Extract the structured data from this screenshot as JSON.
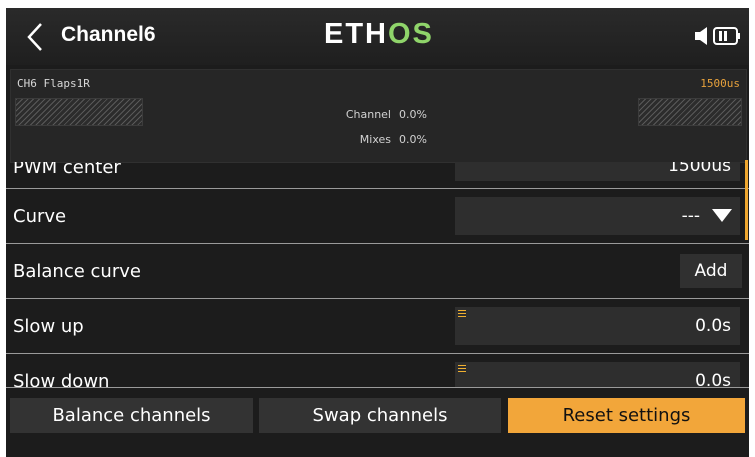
{
  "header": {
    "title": "Channel6",
    "logo_left": "ETH",
    "logo_right": "OS"
  },
  "output": {
    "channel_name": "CH6  Flaps1R",
    "value": "1500us",
    "channel_label": "Channel",
    "channel_value": "0.0%",
    "mixes_label": "Mixes",
    "mixes_value": "0.0%"
  },
  "rows": {
    "pwm_center": {
      "label": "PWM center",
      "value": "1500us"
    },
    "curve": {
      "label": "Curve",
      "value": "---"
    },
    "balance_curve": {
      "label": "Balance curve",
      "button": "Add"
    },
    "slow_up": {
      "label": "Slow up",
      "value": "0.0s"
    },
    "slow_down": {
      "label": "Slow down",
      "value": "0.0s"
    }
  },
  "buttons": {
    "balance": "Balance channels",
    "swap": "Swap channels",
    "reset": "Reset settings"
  },
  "colors": {
    "accent": "#f2a63a",
    "logo_green": "#8fd46a",
    "background": "#1c1c1c"
  },
  "icons": [
    "back-chevron-icon",
    "speaker-icon",
    "battery-icon",
    "dropdown-triangle-icon",
    "slider-handle-icon"
  ]
}
